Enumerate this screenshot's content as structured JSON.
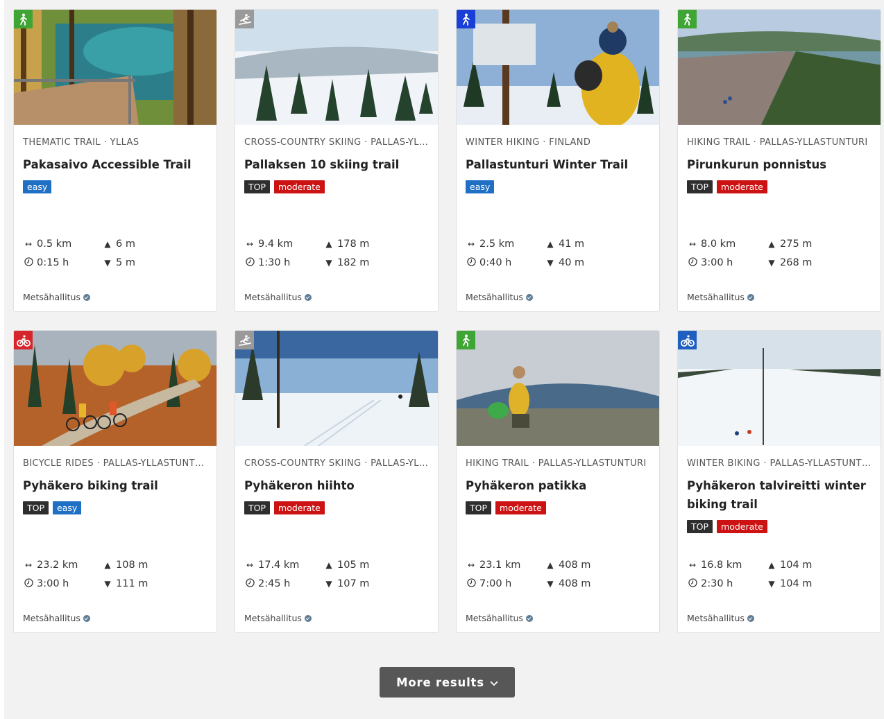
{
  "cards": [
    {
      "category": "THEMATIC TRAIL · YLLÄS",
      "title": "Pakasaivo Accessible Trail",
      "badges": [
        "easy"
      ],
      "length": "0.5 km",
      "duration": "0:15 h",
      "ascent": "6 m",
      "descent": "5 m",
      "provider": "Metsähallitus",
      "icon": "accessible-hiking-icon",
      "icon_color": "#3fa535"
    },
    {
      "category": "CROSS-COUNTRY SKIING · PALLAS-YLLÄSTUNTURI",
      "title": "Pallaksen 10 skiing trail",
      "badges": [
        "TOP",
        "moderate"
      ],
      "length": "9.4 km",
      "duration": "1:30 h",
      "ascent": "178 m",
      "descent": "182 m",
      "provider": "Metsähallitus",
      "icon": "cross-country-skiing-icon",
      "icon_color": "#9a9a9a"
    },
    {
      "category": "WINTER HIKING · FINLAND",
      "title": "Pallastunturi Winter Trail",
      "badges": [
        "easy"
      ],
      "length": "2.5 km",
      "duration": "0:40 h",
      "ascent": "41 m",
      "descent": "40 m",
      "provider": "Metsähallitus",
      "icon": "winter-hiking-icon",
      "icon_color": "#1a3fd6"
    },
    {
      "category": "HIKING TRAIL · PALLAS-YLLÄSTUNTURI",
      "title": "Pirunkurun ponnistus",
      "badges": [
        "TOP",
        "moderate"
      ],
      "length": "8.0 km",
      "duration": "3:00 h",
      "ascent": "275 m",
      "descent": "268 m",
      "provider": "Metsähallitus",
      "icon": "hiking-icon",
      "icon_color": "#3fa535"
    },
    {
      "category": "BICYCLE RIDES · PALLAS-YLLÄSTUNTURI",
      "title": "Pyhäkero biking trail",
      "badges": [
        "TOP",
        "easy"
      ],
      "length": "23.2 km",
      "duration": "3:00 h",
      "ascent": "108 m",
      "descent": "111 m",
      "provider": "Metsähallitus",
      "icon": "bicycle-icon",
      "icon_color": "#d7262b"
    },
    {
      "category": "CROSS-COUNTRY SKIING · PALLAS-YLLÄSTUNTURI",
      "title": "Pyhäkeron hiihto",
      "badges": [
        "TOP",
        "moderate"
      ],
      "length": "17.4 km",
      "duration": "2:45 h",
      "ascent": "105 m",
      "descent": "107 m",
      "provider": "Metsähallitus",
      "icon": "cross-country-skiing-icon",
      "icon_color": "#9a9a9a"
    },
    {
      "category": "HIKING TRAIL · PALLAS-YLLÄSTUNTURI",
      "title": "Pyhäkeron patikka",
      "badges": [
        "TOP",
        "moderate"
      ],
      "length": "23.1 km",
      "duration": "7:00 h",
      "ascent": "408 m",
      "descent": "408 m",
      "provider": "Metsähallitus",
      "icon": "hiking-icon",
      "icon_color": "#3fa535"
    },
    {
      "category": "WINTER BIKING · PALLAS-YLLÄSTUNTURI",
      "title": "Pyhäkeron talvireitti winter biking trail",
      "badges": [
        "TOP",
        "moderate"
      ],
      "length": "16.8 km",
      "duration": "2:30 h",
      "ascent": "104 m",
      "descent": "104 m",
      "provider": "Metsähallitus",
      "icon": "winter-biking-icon",
      "icon_color": "#1f5fbf"
    }
  ],
  "more_button": {
    "label": "More results"
  }
}
